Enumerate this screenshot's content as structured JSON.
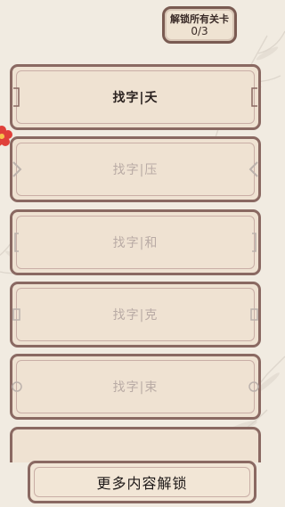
{
  "header": {
    "unlock_all_label": "解锁所有关卡",
    "progress": "0/3"
  },
  "levels": [
    {
      "label": "找字|夭",
      "locked": false
    },
    {
      "label": "找字|压",
      "locked": true
    },
    {
      "label": "找字|和",
      "locked": true
    },
    {
      "label": "找字|克",
      "locked": true
    },
    {
      "label": "找字|束",
      "locked": true
    }
  ],
  "footer": {
    "more_content_label": "更多内容解锁"
  },
  "colors": {
    "background": "#f1ebe1",
    "card_fill": "#efe2d2",
    "card_border": "#8a6962",
    "locked_text": "#b9aba5",
    "active_text": "#2b2220",
    "flower": "#e0403a"
  }
}
